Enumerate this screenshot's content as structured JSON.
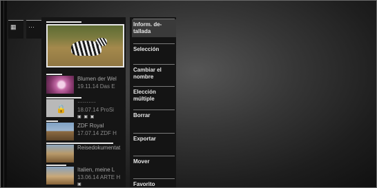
{
  "side_tiles": [
    {
      "label": "▦",
      "name": "clapperboard-icon"
    },
    {
      "label": "···",
      "name": "more-dots-icon"
    }
  ],
  "featured": {
    "progress_pct": 45
  },
  "recordings": [
    {
      "title": "Blumen der Wel",
      "subtitle": "19.11.14 Das E",
      "flags": "",
      "progress_pct": 20
    },
    {
      "title": "··········",
      "subtitle": "18.07.14 ProSi",
      "flags": "▣ ▣ ▣",
      "progress_pct": 45,
      "locked": true
    },
    {
      "title": "ZDF Royal",
      "subtitle": "17.07.14 ZDF H",
      "flags": "",
      "progress_pct": 15
    },
    {
      "title": "Reisedokumentat",
      "subtitle": "",
      "flags": "",
      "progress_pct": 85
    },
    {
      "title": "Italien, meine L",
      "subtitle": "13.06.14 ARTE H",
      "flags": "▣",
      "progress_pct": 25
    }
  ],
  "menu": {
    "items": [
      {
        "label": "Inform. de-\ntallada",
        "active": true
      },
      {
        "label": "Selección"
      },
      {
        "label": "Cambiar el\nnombre"
      },
      {
        "label": "Elección\nmúltiple"
      },
      {
        "label": "Borrar"
      },
      {
        "label": "Exportar"
      },
      {
        "label": "Mover"
      },
      {
        "label": "Favorito"
      }
    ]
  }
}
